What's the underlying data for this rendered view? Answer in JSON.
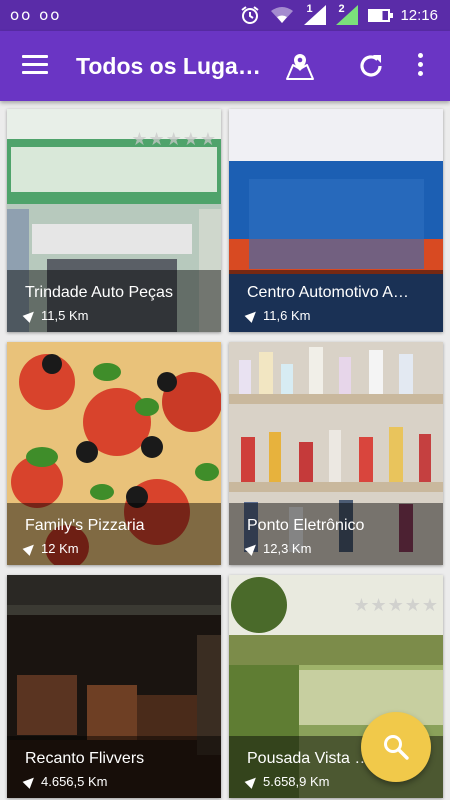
{
  "status_bar": {
    "left_icons": "oo oo",
    "time": "12:16",
    "sim1": "1",
    "sim2": "2"
  },
  "app_bar": {
    "title": "Todos os Luga…",
    "icons": [
      "menu-icon",
      "map-icon",
      "refresh-icon",
      "more-vert-icon"
    ]
  },
  "places": [
    {
      "name": "Trindade Auto Peças",
      "distance": "11,5 Km"
    },
    {
      "name": "Centro Automotivo A…",
      "distance": "11,6 Km"
    },
    {
      "name": "Family's Pizzaria",
      "distance": "12 Km"
    },
    {
      "name": "Ponto Eletrônico",
      "distance": "12,3 Km"
    },
    {
      "name": "Recanto Flivvers",
      "distance": "4.656,5 Km"
    },
    {
      "name": "Pousada Vista …",
      "distance": "5.658,9 Km"
    }
  ],
  "stars": "★★★★★",
  "fab": {
    "icon": "search-icon"
  },
  "colors": {
    "primary": "#6a35c4",
    "status_bar": "#5a2ca8",
    "fab": "#f1c94a"
  }
}
